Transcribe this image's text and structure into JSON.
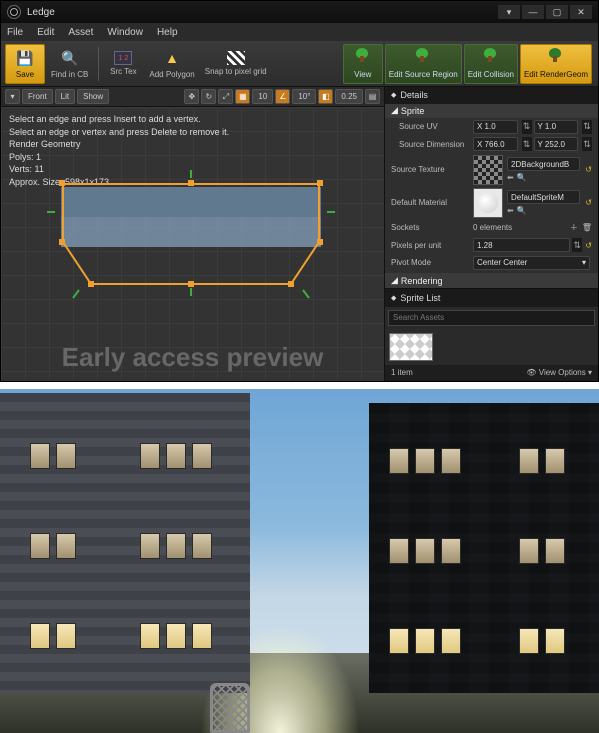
{
  "window": {
    "title": "Ledge"
  },
  "menu": {
    "items": [
      "File",
      "Edit",
      "Asset",
      "Window",
      "Help"
    ]
  },
  "toolbar": {
    "save": "Save",
    "find": "Find in CB",
    "srctex": "Src Tex",
    "addpoly": "Add Polygon",
    "snap": "Snap to pixel grid",
    "view": "View",
    "editsrc": "Edit Source Region",
    "editcol": "Edit Collision",
    "editrender": "Edit RenderGeom"
  },
  "viewportToolbar": {
    "front": "Front",
    "lit": "Lit",
    "show": "Show",
    "val1": "10",
    "val2": "10°",
    "val3": "0.25"
  },
  "viewport": {
    "hint1": "Select an edge and press Insert to add a vertex.",
    "hint2": "Select an edge or vertex and press Delete to remove it.",
    "renderGeom": "Render Geometry",
    "polys": "Polys: 1",
    "verts": "Verts: 11",
    "approx": "Approx. Size: 598x1x173",
    "watermark": "Early access preview"
  },
  "details": {
    "panel": "Details",
    "sprite": "Sprite",
    "sourceUV_lbl": "Source UV",
    "sourceUV_x": "X 1.0",
    "sourceUV_y": "Y 1.0",
    "sourceDim_lbl": "Source Dimension",
    "sourceDim_x": "X 766.0",
    "sourceDim_y": "Y 252.0",
    "sourceTex_lbl": "Source Texture",
    "sourceTex_val": "2DBackgroundB",
    "defMat_lbl": "Default Material",
    "defMat_val": "DefaultSpriteM",
    "sockets_lbl": "Sockets",
    "sockets_val": "0 elements",
    "ppu_lbl": "Pixels per unit",
    "ppu_val": "1.28",
    "pivot_lbl": "Pivot Mode",
    "pivot_val": "Center Center",
    "rendering": "Rendering"
  },
  "spriteList": {
    "title": "Sprite List",
    "search": "Search Assets",
    "count": "1 item",
    "viewopt": "View Options"
  }
}
